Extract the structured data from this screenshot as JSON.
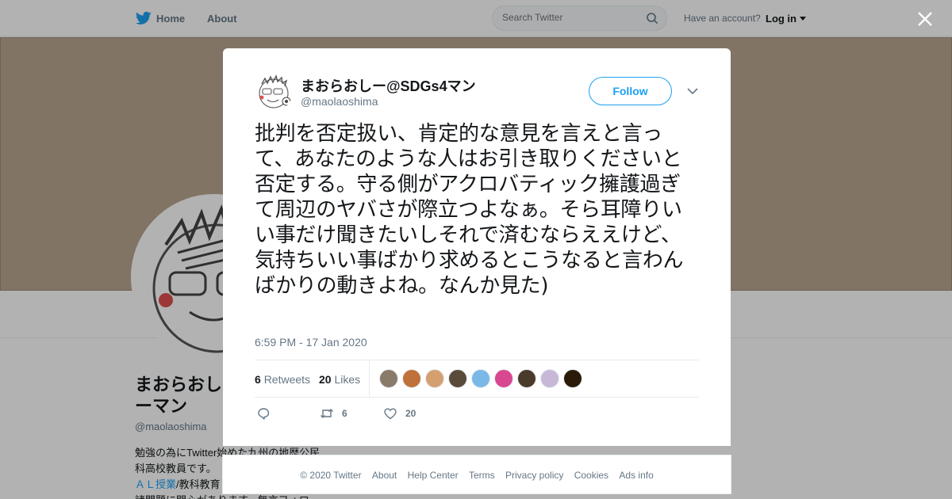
{
  "topbar": {
    "home": "Home",
    "about": "About",
    "search_placeholder": "Search Twitter",
    "have_account": "Have an account?",
    "login": "Log in"
  },
  "profile": {
    "name": "まおらおしーマン",
    "handle": "@maolaoshima",
    "bio_line1": "勉強の為にTwitter始めた九州の地歴公民",
    "bio_line2": "科高校教員です。",
    "bio_link": "ＡＬ授業",
    "bio_line3": "/教科教育",
    "bio_line4": "諸問題に関心があります。無言フォロー"
  },
  "tweet": {
    "name": "まおらおしー@SDGs4マン",
    "handle": "@maolaoshima",
    "follow": "Follow",
    "text": "批判を否定扱い、肯定的な意見を言えと言って、あなたのような人はお引き取りくださいと否定する。守る側がアクロバティック擁護過ぎて周辺のヤバさが際立つよなぁ。そら耳障りいい事だけ聞きたいしそれで済むならええけど、気持ちいい事ばかり求めるとこうなると言わんばかりの動きよね。なんか見た)",
    "time": "6:59 PM - 17 Jan 2020",
    "retweets_count": "6",
    "retweets_label": "Retweets",
    "likes_count": "20",
    "likes_label": "Likes",
    "retweet_action_count": "6",
    "like_action_count": "20",
    "liker_colors": [
      "#8a7a6a",
      "#c0703a",
      "#d4a070",
      "#5a4a3a",
      "#7ab8e8",
      "#d84890",
      "#4a3a2a",
      "#c8b8d8",
      "#2a1a0a"
    ]
  },
  "footer": {
    "copyright": "© 2020 Twitter",
    "about": "About",
    "help": "Help Center",
    "terms": "Terms",
    "privacy": "Privacy policy",
    "cookies": "Cookies",
    "ads": "Ads info"
  }
}
